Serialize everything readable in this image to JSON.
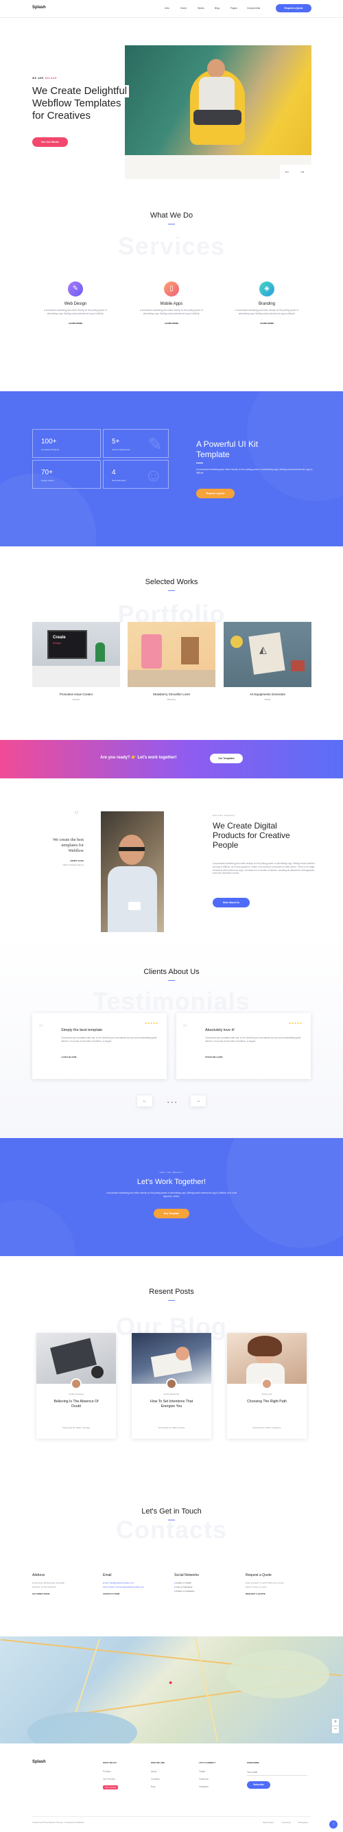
{
  "header": {
    "logo": "Splash",
    "nav": [
      "Intro",
      "Home",
      "Works",
      "Blog",
      "Pages",
      "Components"
    ],
    "cta": "Request a Quote"
  },
  "hero": {
    "tag_prefix": "WE ARE",
    "tag_brand": "SPLASH",
    "title_lines": [
      "We Create Delightful",
      "Webflow Templates",
      "for Creatives"
    ],
    "button": "See Our Works",
    "prev_arrow": "←",
    "next_arrow": "→"
  },
  "what_we_do": {
    "title": "What We Do",
    "bg_word": "Services",
    "items": [
      {
        "icon": "brush-icon",
        "title": "Web Design",
        "text": "A successful marketing plan relies heavily on the pulling-power of advertising copy. Writing result-oriented ad copy is difficult.",
        "link": "LEARN MORE",
        "color": "#8a6cf6"
      },
      {
        "icon": "phone-icon",
        "title": "Mobile Apps",
        "text": "A successful marketing plan relies heavily on the pulling-power of advertising copy. Writing result-oriented ad copy is difficult.",
        "link": "LEARN MORE",
        "color": "#f0627a"
      },
      {
        "icon": "compass-icon",
        "title": "Branding",
        "text": "A successful marketing plan relies heavily on the pulling-power of advertising copy. Writing result-oriented ad copy is difficult.",
        "link": "LEARN MORE",
        "color": "#2cc1d8"
      }
    ]
  },
  "stats": {
    "items": [
      {
        "value": "100+",
        "label": "Completed Projects"
      },
      {
        "value": "5+",
        "label": "Years of Experience"
      },
      {
        "value": "70+",
        "label": "Happy Clients"
      },
      {
        "value": "4",
        "label": "Team Members"
      }
    ],
    "title_lines": [
      "A Powerful UI Kit",
      "Template"
    ],
    "text": "A successful marketing plan relies heavily on the pulling-power of advertising copy. Writing result-oriented ad copy is difficult.",
    "button": "Request a Quote"
  },
  "works": {
    "title": "Selected Works",
    "bg_word": "Portfolio",
    "items": [
      {
        "title": "Promotive Issue Creator",
        "category": "Website"
      },
      {
        "title": "Strawberry Smoothie Lover",
        "category": "Branding"
      },
      {
        "title": "Art Equipments Generator",
        "category": "Mobile"
      }
    ]
  },
  "cta_bar": {
    "text": "Are you ready? 👉 Let's work together!",
    "button": "Our Templates"
  },
  "quote_section": {
    "quote_mark": "“",
    "quote_lines": [
      "We create the best",
      "templates for",
      "Webflow"
    ],
    "name": "HENRY SAGE",
    "role": "CEO of Splash Agency",
    "kicker": "SPLASH AGENCY",
    "title_lines": [
      "We Create Digital",
      "Products for Creative",
      "People"
    ],
    "text": "A successful marketing plan relies heavily on the pulling-power of advertising copy. Writing result-oriented ad copy is difficult, as it must appeal to, entice, and convince consumers to take action. There is no magic formula to write perfect ad copy; it is based on a number of factors, including ad placement, demographic, even the consumer's mood.",
    "button": "More About Us"
  },
  "testimonials": {
    "title": "Clients About Us",
    "bg_word": "Testimonials",
    "items": [
      {
        "title": "Simply the best template",
        "text": "Consumers are inundated with ads, so it's vital that your ad catches the eye and immediately grabs interest. You could do this with a headline, or slogan",
        "author": "LAURA BLOOM",
        "stars": "★★★★★"
      },
      {
        "title": "Absolutely love it!",
        "text": "Consumers are inundated with ads, so it's vital that your ad catches the eye and immediately grabs interest. You could do this with a headline, or slogan",
        "author": "STEVE WILLIAMS",
        "stars": "★★★★★"
      }
    ],
    "prev": "←",
    "next": "→"
  },
  "cta_big": {
    "kicker": "ARE YOU READY?",
    "title": "Let's Work Together!",
    "text": "A successful marketing plan relies heavily on the pulling-power of advertising copy. Writing result-oriented ad copy is difficult, as it must appeal to, entice.",
    "button": "Buy Template"
  },
  "blog": {
    "title": "Resent Posts",
    "bg_word": "Our Blog",
    "items": [
      {
        "author": "Linda Armstrong",
        "title_lines": [
          "Believing Is The Absence Of",
          "Doubt"
        ],
        "meta": "Posted Jan 29, 2018 in Tutorials"
      },
      {
        "author": "Emily Aldersmith",
        "title_lines": [
          "How To Set Intentions That",
          "Energize You"
        ],
        "meta": "Posted Mar 22, 2018 in Guides"
      },
      {
        "author": "Emily Ford",
        "title_lines": [
          "Choosing The Right Path"
        ],
        "meta": "Posted Feb 6, 2018 in Inspiration"
      }
    ]
  },
  "contact": {
    "title": "Let's Get in Touch",
    "bg_word": "Contacts",
    "cols": [
      {
        "title": "Address",
        "lines": [
          "Hong Kong, 88 European Industrial",
          "Network, 12 Tat Ha Street"
        ],
        "link": "GET DIRECTIONS"
      },
      {
        "title": "Email",
        "lines": [
          "Email: hello@splashtemplate.com",
          "Partnerships: business@splashtemplate.com"
        ],
        "link": "CONTACT FORM"
      },
      {
        "title": "Social Networks",
        "lines": [
          "Follow on Twitter",
          "Like on Facebook",
          "Follow on Instagram"
        ],
        "link": ""
      },
      {
        "title": "Request a Quote",
        "lines": [
          "Have a project in mind? We'd love to hear",
          "about it. Drop us a line!"
        ],
        "link": "REQUEST A QUOTE"
      }
    ]
  },
  "footer": {
    "logo": "Splash",
    "cols": [
      {
        "title": "WHAT WE DO",
        "items": [
          "Portfolio",
          "Our Process",
          "Get a Quote"
        ]
      },
      {
        "title": "WHO WE ARE",
        "items": [
          "About",
          "Contacts",
          "Blog"
        ]
      },
      {
        "title": "LET'S CONNECT",
        "items": [
          "Twitter",
          "Facebook",
          "Instagram"
        ]
      }
    ],
    "subscribe_title": "SUBSCRIBE",
    "subscribe_placeholder": "Your email",
    "subscribe_button": "Subscribe",
    "copyright": "Created with ♥ by Rauno Themes · Powered by Webflow",
    "links": [
      "Style Guide",
      "Licensing",
      "Changelog"
    ]
  },
  "colors": {
    "accent": "#4f6cf7",
    "pink": "#f2486c",
    "orange": "#f6a33a",
    "yellow": "#f4c235"
  }
}
